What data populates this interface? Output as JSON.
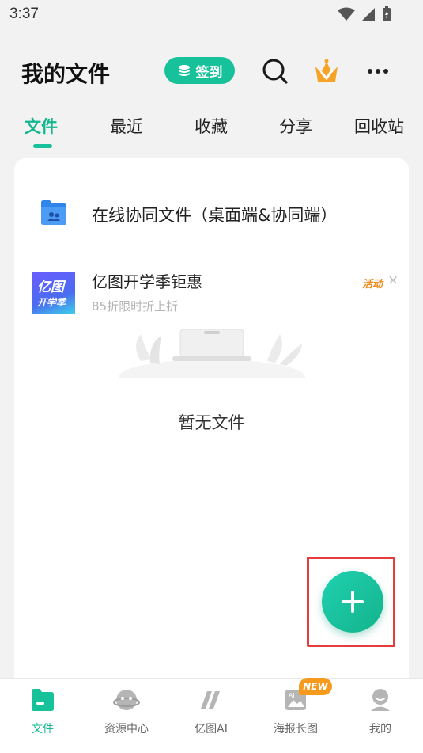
{
  "status_bar": {
    "time": "3:37"
  },
  "header": {
    "title": "我的文件",
    "checkin_label": "签到"
  },
  "tabs": [
    {
      "label": "文件",
      "active": true
    },
    {
      "label": "最近",
      "active": false
    },
    {
      "label": "收藏",
      "active": false
    },
    {
      "label": "分享",
      "active": false
    },
    {
      "label": "回收站",
      "active": false
    }
  ],
  "card": {
    "collab_label": "在线协同文件（桌面端&协同端）",
    "promo": {
      "thumb_line1": "亿图",
      "thumb_line2": "开学季",
      "title": "亿图开学季钜惠",
      "subtitle": "85折限时折上折",
      "tag": "活动",
      "close": "×"
    },
    "empty_text": "暂无文件"
  },
  "bottom_nav": [
    {
      "label": "文件",
      "icon": "folder-icon",
      "active": true
    },
    {
      "label": "资源中心",
      "icon": "planet-icon",
      "active": false
    },
    {
      "label": "亿图AI",
      "icon": "ai-logo-icon",
      "active": false
    },
    {
      "label": "海报长图",
      "icon": "poster-icon",
      "active": false,
      "badge": "NEW"
    },
    {
      "label": "我的",
      "icon": "profile-icon",
      "active": false
    }
  ],
  "colors": {
    "accent": "#17c29a",
    "promo_tag": "#f08a1c",
    "highlight": "#e53c3c"
  }
}
